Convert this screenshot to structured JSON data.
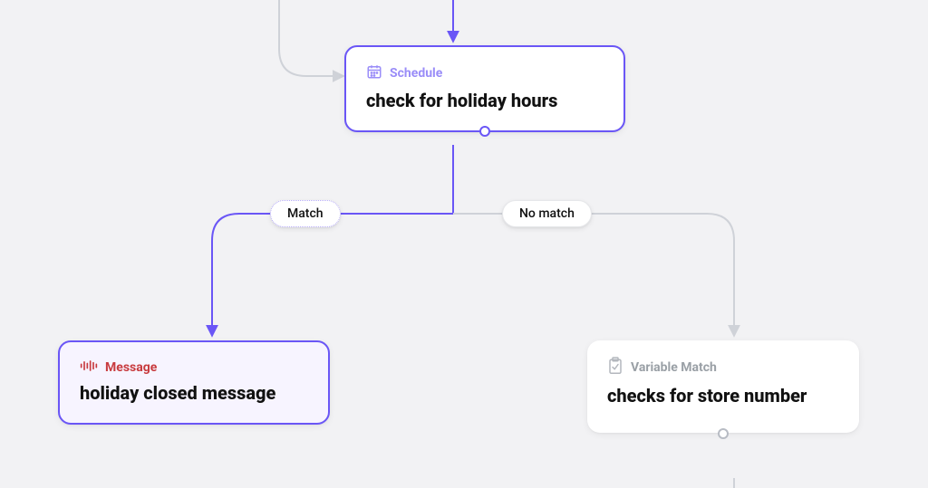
{
  "nodes": {
    "schedule": {
      "type_label": "Schedule",
      "title": "check for holiday hours"
    },
    "message": {
      "type_label": "Message",
      "title": "holiday closed message"
    },
    "varmatch": {
      "type_label": "Variable Match",
      "title": "checks for store number"
    }
  },
  "branches": {
    "match_label": "Match",
    "no_match_label": "No match"
  },
  "colors": {
    "accent": "#6a56f6",
    "accent_light": "#a99ef8",
    "gray_line": "#cfd2d8",
    "message_red": "#c83b3f",
    "muted": "#9aa0a6"
  }
}
